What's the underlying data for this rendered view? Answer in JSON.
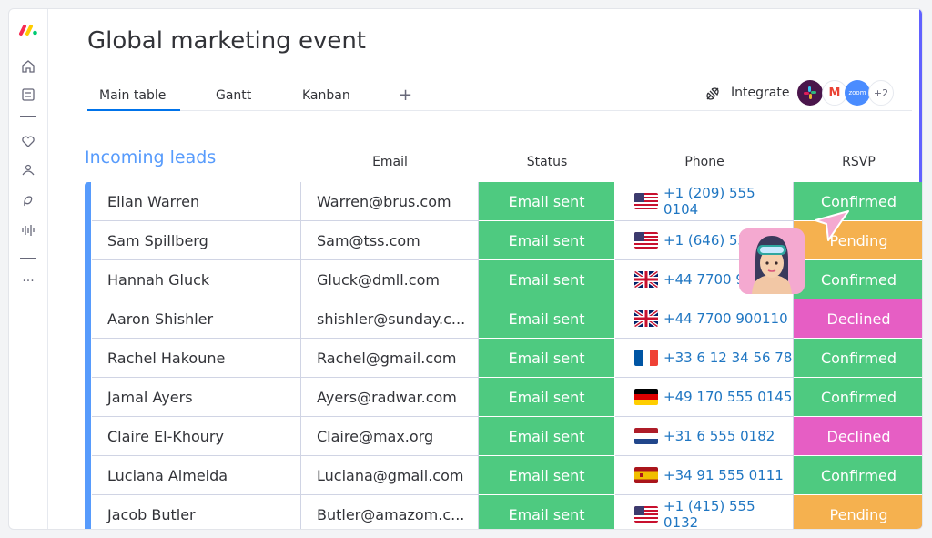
{
  "page": {
    "title": "Global marketing event"
  },
  "tabs": [
    {
      "label": "Main table",
      "active": true
    },
    {
      "label": "Gantt",
      "active": false
    },
    {
      "label": "Kanban",
      "active": false
    }
  ],
  "tab_add": "+",
  "integrate": {
    "label": "Integrate",
    "apps": [
      {
        "name": "slack-icon",
        "text": ""
      },
      {
        "name": "gmail-icon",
        "text": "M"
      },
      {
        "name": "zoom-icon",
        "text": "zoom"
      },
      {
        "name": "more-apps-badge",
        "text": "+2"
      }
    ]
  },
  "group": {
    "title": "Incoming leads",
    "color": "#579bfc"
  },
  "columns": {
    "email": "Email",
    "status": "Status",
    "phone": "Phone",
    "rsvp": "RSVP"
  },
  "colors": {
    "email_sent": "#4eca80",
    "Confirmed": "#4eca80",
    "Pending": "#f5b14f",
    "Declined": "#e65ec4",
    "accent": "#0073ea"
  },
  "rows": [
    {
      "name": "Elian Warren",
      "email": "Warren@brus.com",
      "status": "Email sent",
      "flag": "us",
      "phone": "+1 (209) 555 0104",
      "rsvp": "Confirmed"
    },
    {
      "name": "Sam Spillberg",
      "email": "Sam@tss.com",
      "status": "Email sent",
      "flag": "us",
      "phone": "+1 (646) 555",
      "rsvp": "Pending"
    },
    {
      "name": "Hannah Gluck",
      "email": "Gluck@dmll.com",
      "status": "Email sent",
      "flag": "uk",
      "phone": "+44 7700 90",
      "rsvp": "Confirmed"
    },
    {
      "name": "Aaron Shishler",
      "email": "shishler@sunday.c...",
      "status": "Email sent",
      "flag": "uk",
      "phone": "+44 7700 900110",
      "rsvp": "Declined"
    },
    {
      "name": "Rachel Hakoune",
      "email": "Rachel@gmail.com",
      "status": "Email sent",
      "flag": "fr",
      "phone": "+33 6 12 34 56 78",
      "rsvp": "Confirmed"
    },
    {
      "name": "Jamal Ayers",
      "email": "Ayers@radwar.com",
      "status": "Email sent",
      "flag": "de",
      "phone": "+49 170 555 0145",
      "rsvp": "Confirmed"
    },
    {
      "name": "Claire El-Khoury",
      "email": "Claire@max.org",
      "status": "Email sent",
      "flag": "nl",
      "phone": "+31 6 555 0182",
      "rsvp": "Declined"
    },
    {
      "name": "Luciana Almeida",
      "email": "Luciana@gmail.com",
      "status": "Email sent",
      "flag": "es",
      "phone": "+34 91 555 0111",
      "rsvp": "Confirmed"
    },
    {
      "name": "Jacob Butler",
      "email": "Butler@amazom.c...",
      "status": "Email sent",
      "flag": "us",
      "phone": "+1 (415) 555 0132",
      "rsvp": "Pending"
    }
  ]
}
